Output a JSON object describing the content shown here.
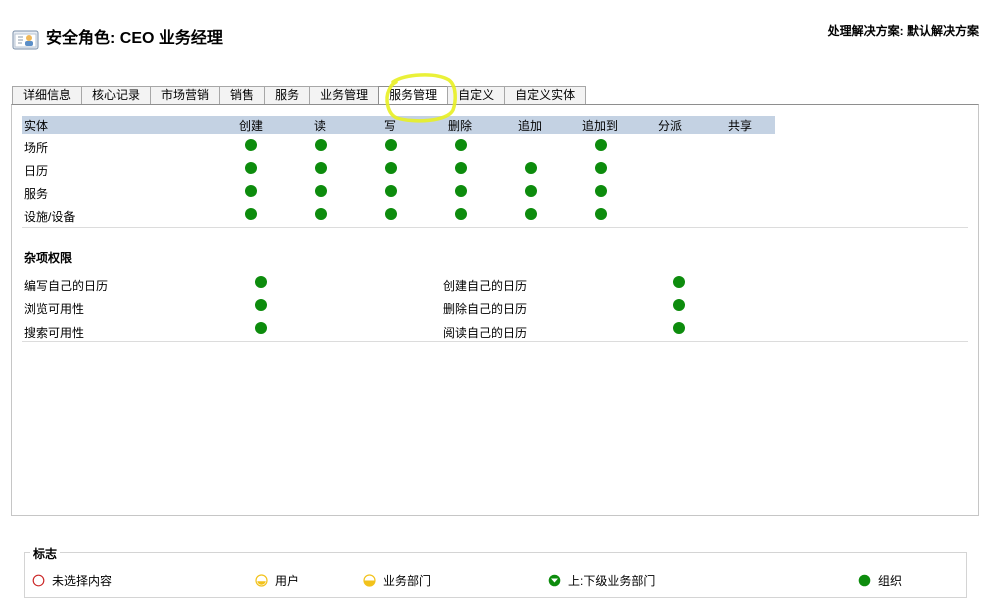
{
  "header": {
    "title": "安全角色: CEO 业务经理",
    "solution": "处理解决方案: 默认解决方案"
  },
  "tabs": [
    {
      "label": "详细信息",
      "active": false
    },
    {
      "label": "核心记录",
      "active": false
    },
    {
      "label": "市场营销",
      "active": false
    },
    {
      "label": "销售",
      "active": false
    },
    {
      "label": "服务",
      "active": false
    },
    {
      "label": "业务管理",
      "active": false
    },
    {
      "label": "服务管理",
      "active": true
    },
    {
      "label": "自定义",
      "active": false
    },
    {
      "label": "自定义实体",
      "active": false
    }
  ],
  "entity_grid": {
    "headers": [
      "实体",
      "创建",
      "读",
      "写",
      "删除",
      "追加",
      "追加到",
      "分派",
      "共享"
    ],
    "rows": [
      {
        "name": "场所",
        "perms": [
          "organization",
          "organization",
          "organization",
          "organization",
          "",
          "organization",
          "",
          ""
        ]
      },
      {
        "name": "日历",
        "perms": [
          "organization",
          "organization",
          "organization",
          "organization",
          "organization",
          "organization",
          "",
          ""
        ]
      },
      {
        "name": "服务",
        "perms": [
          "organization",
          "organization",
          "organization",
          "organization",
          "organization",
          "organization",
          "",
          ""
        ]
      },
      {
        "name": "设施/设备",
        "perms": [
          "organization",
          "organization",
          "organization",
          "organization",
          "organization",
          "organization",
          "",
          ""
        ]
      }
    ]
  },
  "misc": {
    "title": "杂项权限",
    "items": [
      {
        "label": "编写自己的日历",
        "level": "organization"
      },
      {
        "label": "浏览可用性",
        "level": "organization"
      },
      {
        "label": "搜索可用性",
        "level": "organization"
      },
      {
        "label": "创建自己的日历",
        "level": "organization"
      },
      {
        "label": "删除自己的日历",
        "level": "organization"
      },
      {
        "label": "阅读自己的日历",
        "level": "organization"
      }
    ]
  },
  "legend": {
    "title": "标志",
    "items": [
      {
        "label": "未选择内容",
        "icon": "empty-circle-icon"
      },
      {
        "label": "用户",
        "icon": "user-level-icon"
      },
      {
        "label": "业务部门",
        "icon": "business-unit-icon"
      },
      {
        "label": "上:下级业务部门",
        "icon": "parent-child-bu-icon"
      },
      {
        "label": "组织",
        "icon": "organization-icon"
      }
    ]
  },
  "colors": {
    "organization": "#0d8c0d",
    "grid_header": "#c4d2e3",
    "user_yellow": "#f2c21b",
    "none_red": "#cc2a2a",
    "highlight": "#e8f022"
  }
}
